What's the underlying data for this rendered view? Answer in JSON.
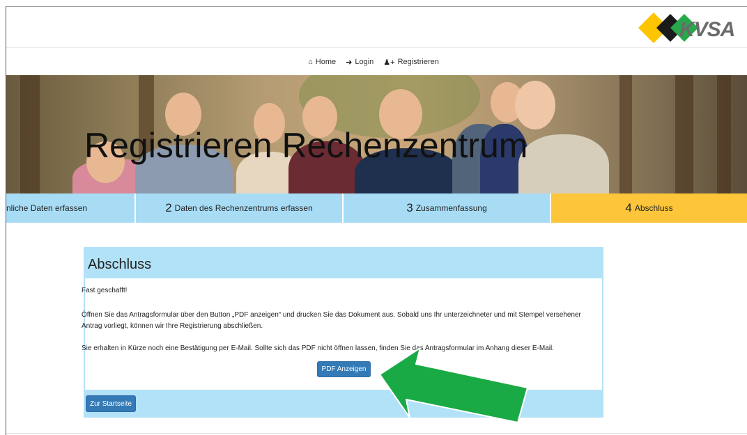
{
  "brand": {
    "logo_text": "KVSA",
    "colors": {
      "yellow": "#fdc400",
      "black": "#1a1a1a",
      "green": "#27a84a"
    }
  },
  "nav": {
    "items": [
      {
        "icon": "home-icon",
        "label": "Home"
      },
      {
        "icon": "login-icon",
        "label": "Login"
      },
      {
        "icon": "user-plus-icon",
        "label": "Registrieren"
      }
    ]
  },
  "hero": {
    "title": "Registrieren Rechenzentrum"
  },
  "steps": [
    {
      "num": "",
      "label": "nliche Daten erfassen",
      "color": "#a8dcf5"
    },
    {
      "num": "2",
      "label": "Daten des Rechenzentrums erfassen",
      "color": "#a8dcf5"
    },
    {
      "num": "3",
      "label": "Zusammenfassung",
      "color": "#a8dcf5"
    },
    {
      "num": "4",
      "label": "Abschluss",
      "color": "#fdc53a",
      "active": true
    }
  ],
  "panel": {
    "title": "Abschluss",
    "paragraph_1": "Fast geschafft!",
    "paragraph_2": "Öffnen Sie das Antragsformular über den Button „PDF anzeigen“ und drucken Sie das Dokument aus. Sobald uns Ihr unterzeichneter und mit Stempel versehener Antrag vorliegt, können wir Ihre Registrierung abschließen.",
    "paragraph_3": "Sie erhalten in Kürze noch eine Bestätigung per E-Mail. Sollte sich das PDF nicht öffnen lassen, finden Sie das Antragsformular im Anhang dieser E-Mail.",
    "pdf_button": "PDF Anzeigen",
    "start_button": "Zur Startseite",
    "accent_color": "#b2e2f8",
    "button_color": "#337ab7"
  },
  "annotation": {
    "arrow_color": "#1aaa45"
  }
}
